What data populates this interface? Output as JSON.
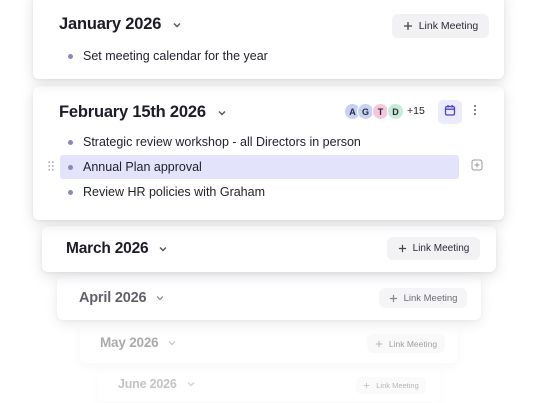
{
  "months": {
    "january": {
      "title": "January 2026",
      "link_label": "Link Meeting",
      "items": [
        "Set meeting calendar for the year"
      ]
    },
    "february": {
      "title": "February 15th 2026",
      "items": [
        "Strategic review workshop - all Directors in person",
        "Annual Plan approval",
        "Review HR policies with Graham"
      ],
      "attendees": [
        {
          "initial": "A",
          "color": "#c7cff6"
        },
        {
          "initial": "G",
          "color": "#c6d3f3"
        },
        {
          "initial": "T",
          "color": "#f6c6dc"
        },
        {
          "initial": "D",
          "color": "#c4ecd6"
        }
      ],
      "extra_count": "+15"
    },
    "march": {
      "title": "March 2026",
      "link_label": "Link Meeting"
    },
    "april": {
      "title": "April 2026",
      "link_label": "Link Meeting"
    },
    "may": {
      "title": "May 2026",
      "link_label": "Link Meeting"
    },
    "june": {
      "title": "June 2026",
      "link_label": "Link Meeting"
    }
  },
  "colors": {
    "accent": "#4b3fd6",
    "highlight": "#e3e4fb",
    "bullet": "#8b89b8"
  }
}
